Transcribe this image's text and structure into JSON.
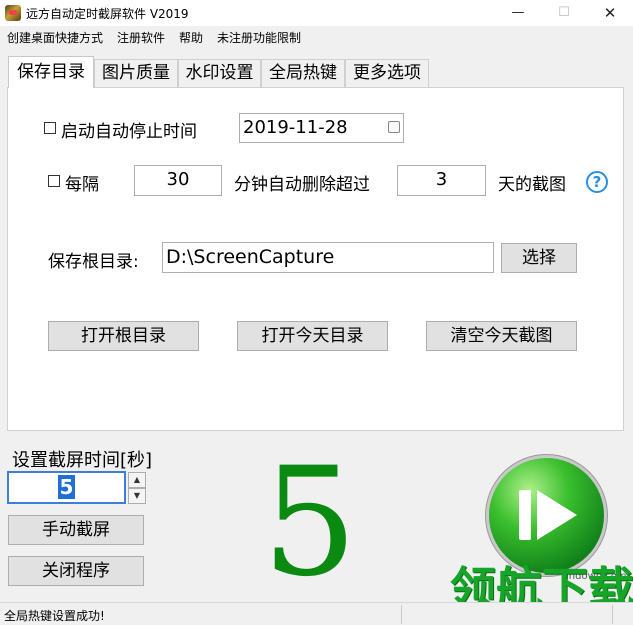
{
  "window": {
    "title": "远方自动定时截屏软件 V2019",
    "minimize": "—",
    "maximize": "☐",
    "close": "✕"
  },
  "menu": [
    "创建桌面快捷方式",
    "注册软件",
    "帮助",
    "未注册功能限制"
  ],
  "tabs": [
    "保存目录",
    "图片质量",
    "水印设置",
    "全局热键",
    "更多选项"
  ],
  "auto_stop": {
    "label": "启动自动停止时间",
    "checked": false,
    "date": "2019-11-28"
  },
  "auto_delete": {
    "label_every": "每隔",
    "checked": false,
    "interval": "30",
    "label_mid": "分钟自动删除超过",
    "days": "3",
    "label_end": "天的截图",
    "help_glyph": "?"
  },
  "save_dir": {
    "label": "保存根目录:",
    "value": "D:\\ScreenCapture",
    "choose_label": "选择"
  },
  "actions": {
    "open_root": "打开根目录",
    "open_today": "打开今天目录",
    "clear_today": "清空今天截图"
  },
  "interval": {
    "label": "设置截屏时间[秒]",
    "value": "5",
    "up": "▲",
    "down": "▼"
  },
  "manual_capture_label": "手动截屏",
  "close_program_label": "关闭程序",
  "countdown": "5",
  "watermark": {
    "text": "领航下载",
    "site": "lhdown.com"
  },
  "status": "全局热键设置成功!",
  "colors": {
    "countdown": "#0a8a10",
    "play": "#12831b",
    "help": "#2a8fdc"
  }
}
